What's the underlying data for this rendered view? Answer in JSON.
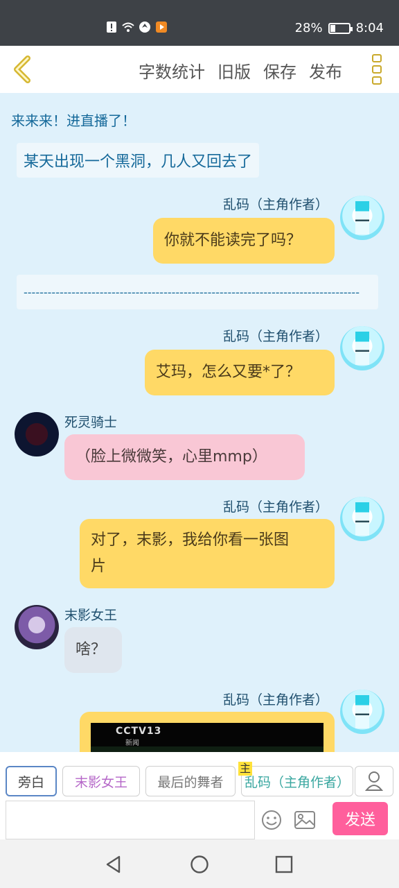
{
  "status": {
    "battery": "28%",
    "time": "8:04",
    "battery_level": 0.28
  },
  "toolbar": {
    "actions": [
      "字数统计",
      "旧版",
      "保存",
      "发布"
    ]
  },
  "messages": {
    "m0": {
      "type": "narration",
      "text": "来来来！进直播了！"
    },
    "m1": {
      "type": "narration",
      "text": "某天出现一个黑洞，几人又回去了"
    },
    "m2": {
      "name": "乱码（主角作者）",
      "text": "你就不能读完了吗？"
    },
    "m3": {
      "type": "narration",
      "text": "------------------------------------------------------------------------------------"
    },
    "m4": {
      "name": "乱码（主角作者）",
      "text": "艾玛，怎么又要*了？"
    },
    "m5": {
      "name": "死灵骑士",
      "text": "（脸上微微笑，心里mmp）"
    },
    "m6": {
      "name": "乱码（主角作者）",
      "line1": "对了，末影，我给你看一张图",
      "line2": "片"
    },
    "m7": {
      "name": "末影女王",
      "text": "啥？"
    },
    "m8": {
      "name": "乱码（主角作者）",
      "image_logo": "CCTV13",
      "image_sub": "新闻"
    }
  },
  "characters": {
    "c0": "旁白",
    "c1": "末影女王",
    "c2": "最后的舞者",
    "c3": "乱码（主角作者）",
    "c3_badge": "主"
  },
  "composer": {
    "send_label": "发送",
    "placeholder": ""
  },
  "colors": {
    "accent_send": "#ff5f9c",
    "bubble_self": "#ffd966",
    "bubble_pink": "#f9c7d5",
    "background": "#dff1fb"
  }
}
